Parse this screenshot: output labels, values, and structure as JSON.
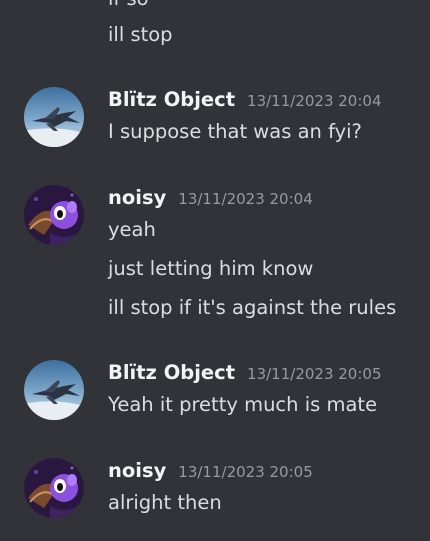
{
  "partial_top": {
    "line1": "if so",
    "line2": "ill stop"
  },
  "messages": [
    {
      "username": "Blïtz Object",
      "timestamp": "13/11/2023 20:04",
      "avatar_icon": "jet-plane-avatar-icon",
      "lines": [
        "I suppose that was an fyi?"
      ]
    },
    {
      "username": "noisy",
      "timestamp": "13/11/2023 20:04",
      "avatar_icon": "purple-character-avatar-icon",
      "lines": [
        "yeah",
        "just letting him know",
        "ill stop if it's against the rules"
      ]
    },
    {
      "username": "Blïtz Object",
      "timestamp": "13/11/2023 20:05",
      "avatar_icon": "jet-plane-avatar-icon",
      "lines": [
        "Yeah it pretty much is mate"
      ]
    },
    {
      "username": "noisy",
      "timestamp": "13/11/2023 20:05",
      "avatar_icon": "purple-character-avatar-icon",
      "lines": [
        "alright then"
      ]
    }
  ],
  "colors": {
    "background": "#313338",
    "username": "#f2f3f5",
    "timestamp": "#949ba4",
    "message_text": "#dbdee1"
  }
}
